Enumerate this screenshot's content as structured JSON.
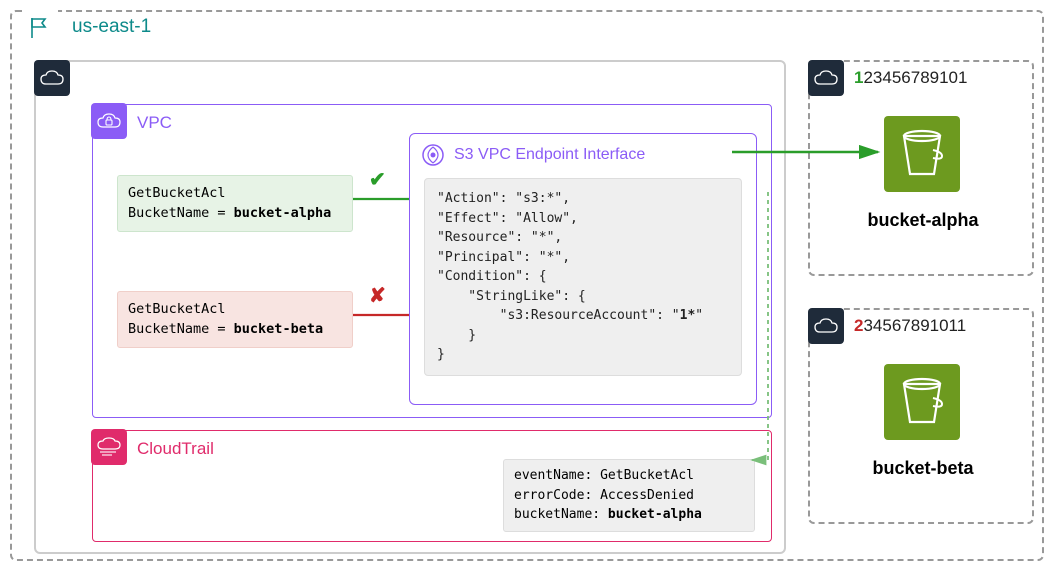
{
  "region": "us-east-1",
  "vpc": {
    "label": "VPC",
    "endpoint_label": "S3 VPC Endpoint Interface"
  },
  "requests": {
    "alpha": {
      "action": "GetBucketAcl",
      "bucket_key": "BucketName = ",
      "bucket_val": "bucket-alpha"
    },
    "beta": {
      "action": "GetBucketAcl",
      "bucket_key": "BucketName = ",
      "bucket_val": "bucket-beta"
    }
  },
  "policy": {
    "l1": "\"Action\": \"s3:*\",",
    "l2": "\"Effect\": \"Allow\",",
    "l3": "\"Resource\": \"*\",",
    "l4": "\"Principal\": \"*\",",
    "l5": "\"Condition\": {",
    "l6": "    \"StringLike\": {",
    "l7a": "        \"s3:ResourceAccount\": \"",
    "l7b": "1*",
    "l7c": "\"",
    "l8": "    }",
    "l9": "}"
  },
  "cloudtrail": {
    "label": "CloudTrail",
    "event": {
      "r1k": "eventName: ",
      "r1v": "GetBucketAcl",
      "r2k": "errorCode: ",
      "r2v": "AccessDenied",
      "r3k": "bucketName: ",
      "r3v": "bucket-alpha"
    }
  },
  "accounts": {
    "a": {
      "first": "1",
      "rest": "23456789101",
      "bucket": "bucket-alpha"
    },
    "b": {
      "first": "2",
      "rest": "34567891011",
      "bucket": "bucket-beta"
    }
  }
}
